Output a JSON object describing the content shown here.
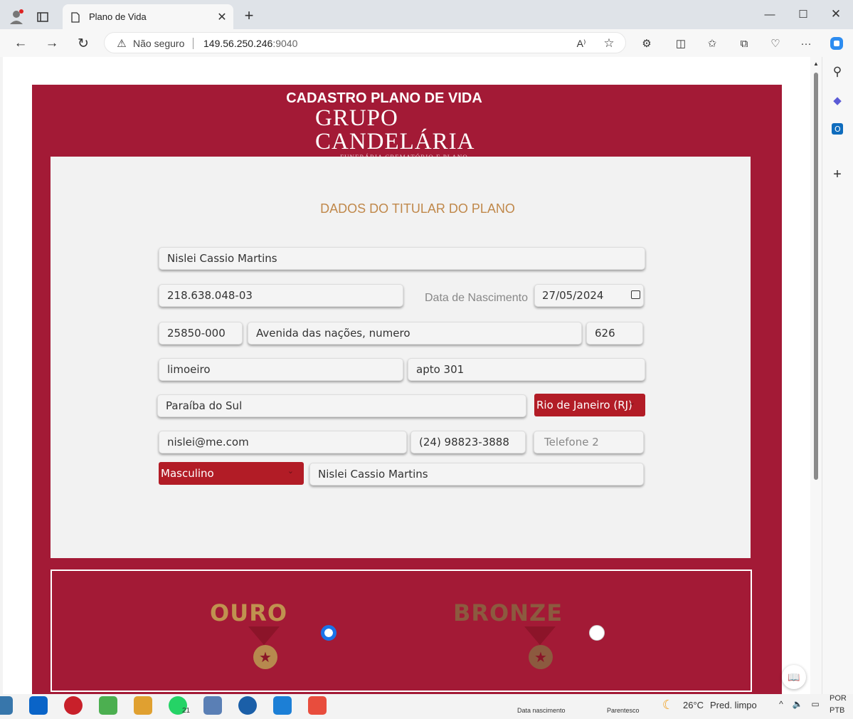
{
  "browser": {
    "tab_title": "Plano de Vida",
    "new_tab": "+",
    "security_label": "Não seguro",
    "url_host": "149.56.250.246",
    "url_port": ":9040",
    "window_controls": [
      "minimize-icon",
      "maximize-icon",
      "close-icon"
    ]
  },
  "page": {
    "title": "CADASTRO PLANO DE VIDA",
    "logo": {
      "line1": "GRUPO",
      "line2": "CANDELÁRIA",
      "tagline": "FUNERÁRIA CREMATÓRIO E PLANO"
    },
    "section_title": "DADOS DO TITULAR DO PLANO",
    "form": {
      "nome": "Nislei Cassio Martins",
      "cpf": "218.638.048-03",
      "data_nascimento_label": "Data de Nascimento",
      "data_nascimento": "27/05/2024",
      "cep": "25850-000",
      "endereco": "Avenida das nações, numero",
      "numero": "626",
      "bairro": "limoeiro",
      "complemento": "apto 301",
      "cidade": "Paraíba do Sul",
      "estado": "Rio de Janeiro (RJ)",
      "email": "nislei@me.com",
      "telefone1": "(24) 98823-3888",
      "telefone2_placeholder": "Telefone 2",
      "sexo": "Masculino",
      "nome_confirmacao": "Nislei Cassio Martins"
    },
    "plans": [
      {
        "name": "OURO",
        "selected": true
      },
      {
        "name": "BRONZE",
        "selected": false
      }
    ]
  },
  "peek": {
    "data_nascimento": "Data nascimento",
    "parentesco": "Parentesco"
  },
  "taskbar": {
    "whatsapp_badge": "21",
    "weather": "26°C",
    "weather_desc": "Pred. limpo",
    "lang1": "POR",
    "lang2": "PTB"
  }
}
